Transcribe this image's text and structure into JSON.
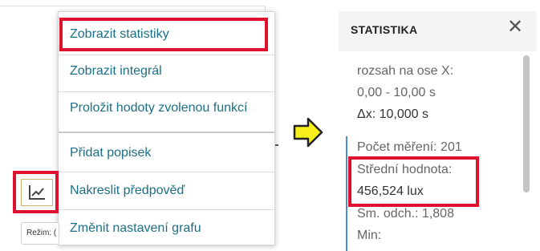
{
  "menu": {
    "items": [
      {
        "label": "Zobrazit statistiky"
      },
      {
        "label": "Zobrazit integrál"
      },
      {
        "label": "Proložit hodoty zvolenou funkcí"
      },
      {
        "label": "Přidat popisek"
      },
      {
        "label": "Nakreslit předpověď"
      },
      {
        "label": "Změnit nastavení grafu"
      }
    ]
  },
  "toolbar": {
    "mode_label": "Režim: ("
  },
  "panel": {
    "title": "STATISTIKA",
    "close": "✕",
    "range_label": "rozsah na ose X:",
    "range_value": "0,00 - 10,00 s",
    "delta_label": "Δx: 10,000 s",
    "count_label": "Počet měření: 201",
    "mean_label": "Střední hodnota:",
    "mean_value": "456,524 lux",
    "sd_label": "Sm. odch.: 1,808",
    "min_label": "Min:"
  },
  "colors": {
    "highlight": "#e0102f",
    "menu_text": "#1b6f86",
    "arrow_fill": "#f6ef1c"
  }
}
